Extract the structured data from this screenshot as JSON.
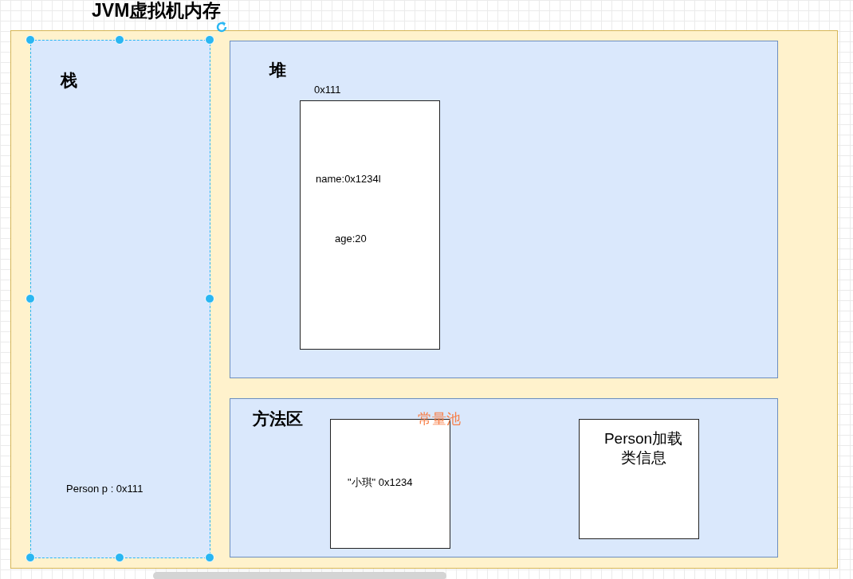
{
  "title": "JVM虚拟机内存",
  "stack": {
    "label": "栈",
    "selected": true,
    "entries": [
      "Person p : 0x111"
    ]
  },
  "heap": {
    "label": "堆",
    "objects": [
      {
        "address": "0x111",
        "fields": [
          "name:0x1234l",
          "age:20"
        ]
      }
    ]
  },
  "method_area": {
    "label": "方法区",
    "boxes": [
      {
        "kind": "constant_pool",
        "caption": "常量池",
        "text": "\"小琪\" 0x1234"
      },
      {
        "kind": "class_info",
        "text": "Person加载类信息"
      }
    ]
  }
}
